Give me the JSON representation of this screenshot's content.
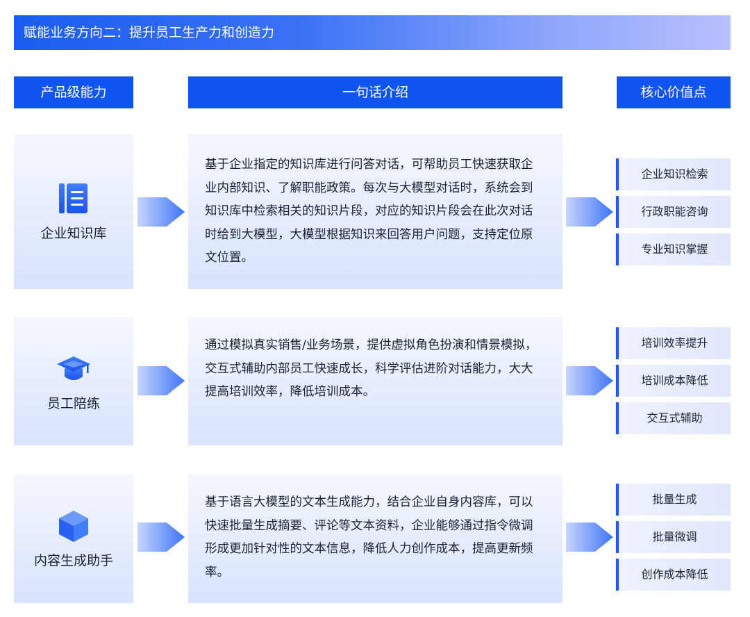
{
  "banner": {
    "title": "赋能业务方向二：提升员工生产力和创造力"
  },
  "headers": {
    "capability": "产品级能力",
    "intro": "一句话介绍",
    "value": "核心价值点"
  },
  "rows": [
    {
      "icon": "document-icon",
      "capability": "企业知识库",
      "description": "基于企业指定的知识库进行问答对话，可帮助员工快速获取企业内部知识、了解职能政策。每次与大模型对话时，系统会到知识库中检索相关的知识片段，对应的知识片段会在此次对话时给到大模型，大模型根据知识来回答用户问题，支持定位原文位置。",
      "values": [
        "企业知识检索",
        "行政职能咨询",
        "专业知识掌握"
      ]
    },
    {
      "icon": "graduation-cap-icon",
      "capability": "员工陪练",
      "description": "通过模拟真实销售/业务场景，提供虚拟角色扮演和情景模拟，交互式辅助内部员工快速成长，科学评估进阶对话能力，大大提高培训效率，降低培训成本。",
      "values": [
        "培训效率提升",
        "培训成本降低",
        "交互式辅助"
      ]
    },
    {
      "icon": "cube-icon",
      "capability": "内容生成助手",
      "description": "基于语言大模型的文本生成能力，结合企业自身内容库，可以快速批量生成摘要、评论等文本资料，企业能够通过指令微调形成更加针对性的文本信息，降低人力创作成本，提高更新频率。",
      "values": [
        "批量生成",
        "批量微调",
        "创作成本降低"
      ]
    }
  ]
}
